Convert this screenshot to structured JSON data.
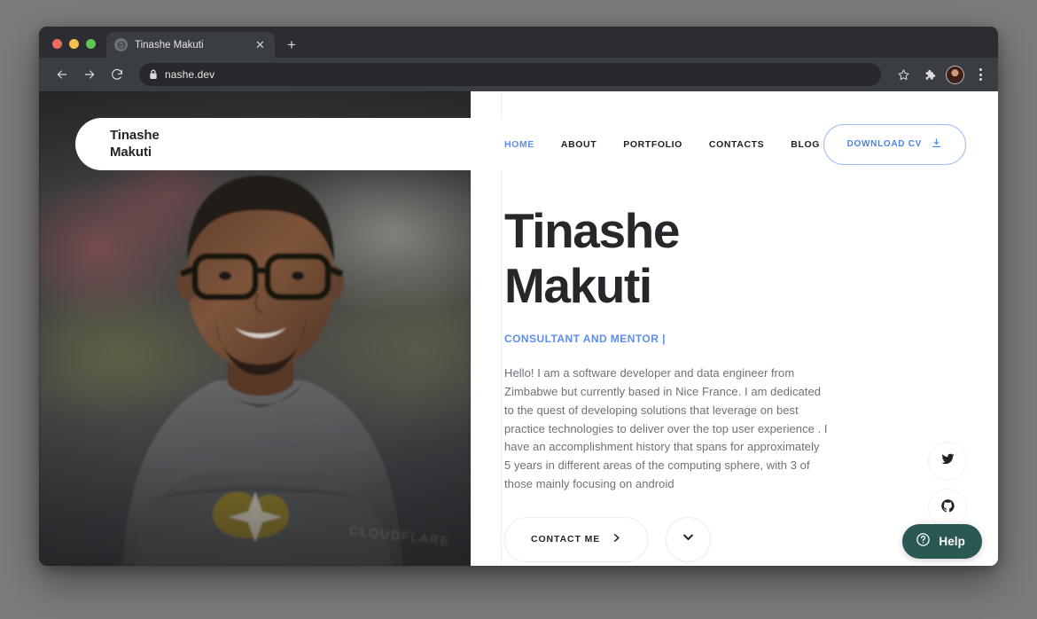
{
  "browser": {
    "tab": {
      "title": "Tinashe Makuti",
      "favicon": "globe-icon",
      "close_label": "✕"
    },
    "new_tab_label": "+",
    "back_icon": "arrow-left-icon",
    "forward_icon": "arrow-right-icon",
    "reload_icon": "reload-icon",
    "address": {
      "url": "nashe.dev",
      "lock_icon": "lock-icon"
    },
    "toolbar_icons": [
      "bookmark-star-icon",
      "extensions-puzzle-icon",
      "profile-avatar-icon",
      "menu-kebab-icon"
    ]
  },
  "site": {
    "logo": {
      "line1": "Tinashe",
      "line2": "Makuti"
    },
    "nav": [
      {
        "label": "HOME",
        "active": true
      },
      {
        "label": "ABOUT",
        "active": false
      },
      {
        "label": "PORTFOLIO",
        "active": false
      },
      {
        "label": "CONTACTS",
        "active": false
      },
      {
        "label": "BLOG",
        "active": false
      }
    ],
    "cv_button": {
      "label": "DOWNLOAD CV",
      "icon": "download-icon"
    },
    "hero": {
      "title_line1": "Tinashe",
      "title_line2": "Makuti",
      "subtitle": "CONSULTANT AND MENTOR |",
      "paragraph": "Hello! I am a software developer and data engineer from Zimbabwe but currently based in Nice France. I am dedicated to the quest of developing solutions that leverage on best practice technologies to deliver over the top user experience . I have an accomplishment history that spans for approximately 5 years in different areas of the computing sphere, with 3 of those mainly focusing on android",
      "primary_cta": {
        "label": "CONTACT ME",
        "icon": "chevron-right-icon"
      },
      "scroll_button_icon": "chevron-down-icon",
      "photo_alt": "Portrait of Tinashe Makuti wearing glasses and a grey Cloudflare t-shirt"
    },
    "social": [
      {
        "name": "twitter",
        "icon": "twitter-icon"
      },
      {
        "name": "github",
        "icon": "github-icon"
      }
    ],
    "help_widget": {
      "label": "Help",
      "icon": "question-circle-icon"
    }
  },
  "colors": {
    "accent_blue": "#5b8ef0",
    "cv_border": "#9dbdf4",
    "text_dark": "#26272b",
    "text_muted": "#6d7178",
    "help_teal": "#2a5853",
    "page_bg": "#7c7c7c"
  }
}
